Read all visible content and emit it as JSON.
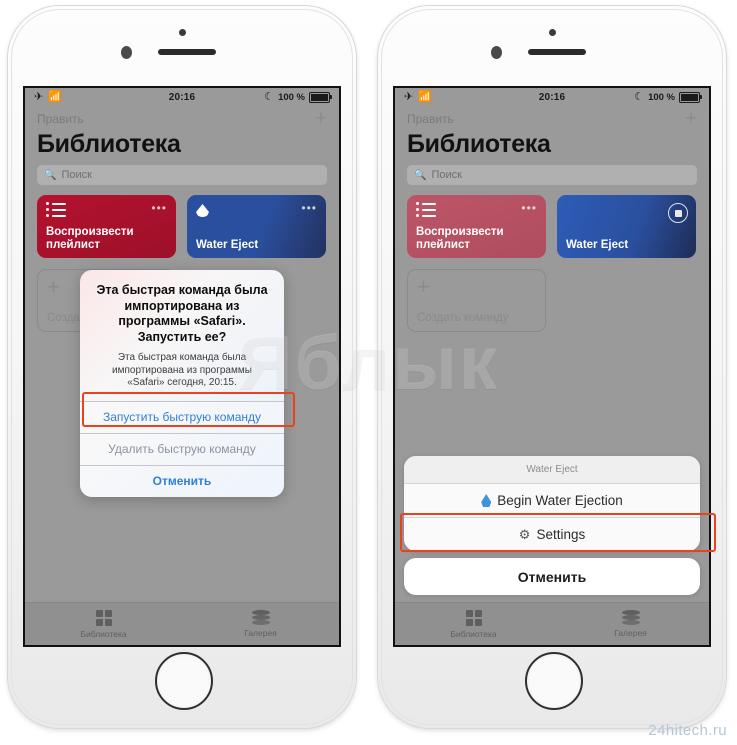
{
  "statusbar": {
    "airplane_icon": "airplane-icon",
    "wifi_icon": "wifi-icon",
    "time": "20:16",
    "dnd_icon": "moon-icon",
    "battery_percent": "100 %",
    "battery_icon": "battery-icon"
  },
  "nav": {
    "edit_label": "Править",
    "add_label": "+",
    "title": "Библиотека"
  },
  "search": {
    "icon": "search-icon",
    "placeholder": "Поиск"
  },
  "cards": {
    "playlist_label": "Воспроизвести плейлист",
    "playlist_icon": "list-icon",
    "playlist_menu": "•••",
    "water_label": "Water Eject",
    "water_icon": "water-drop-icon",
    "water_menu": "•••",
    "water_stop_icon": "stop-button-icon",
    "create_label": "Создать команду",
    "create_label_short": "Создать",
    "create_icon": "plus-icon"
  },
  "tabbar": {
    "library_label": "Библиотека",
    "library_icon": "grid-icon",
    "gallery_label": "Галерея",
    "gallery_icon": "layers-icon"
  },
  "alert": {
    "title": "Эта быстрая команда была импортирована из программы «Safari». Запустить ее?",
    "message": "Эта быстрая команда была импортирована из программы «Safari» сегодня, 20:15.",
    "run_label": "Запустить быструю команду",
    "delete_label": "Удалить быструю команду",
    "cancel_label": "Отменить"
  },
  "sheet": {
    "header": "Water Eject",
    "begin_label": "Begin Water Ejection",
    "begin_icon": "water-drop-icon",
    "settings_label": "Settings",
    "settings_icon": "gear-icon",
    "cancel_label": "Отменить"
  },
  "watermarks": {
    "center": "Яблык",
    "corner": "24hitech.ru"
  },
  "colors": {
    "highlight": "#e8421f",
    "accent_blue": "#2f7fd6",
    "card_red": "#b4122e",
    "card_blue": "#2a4f9e"
  }
}
